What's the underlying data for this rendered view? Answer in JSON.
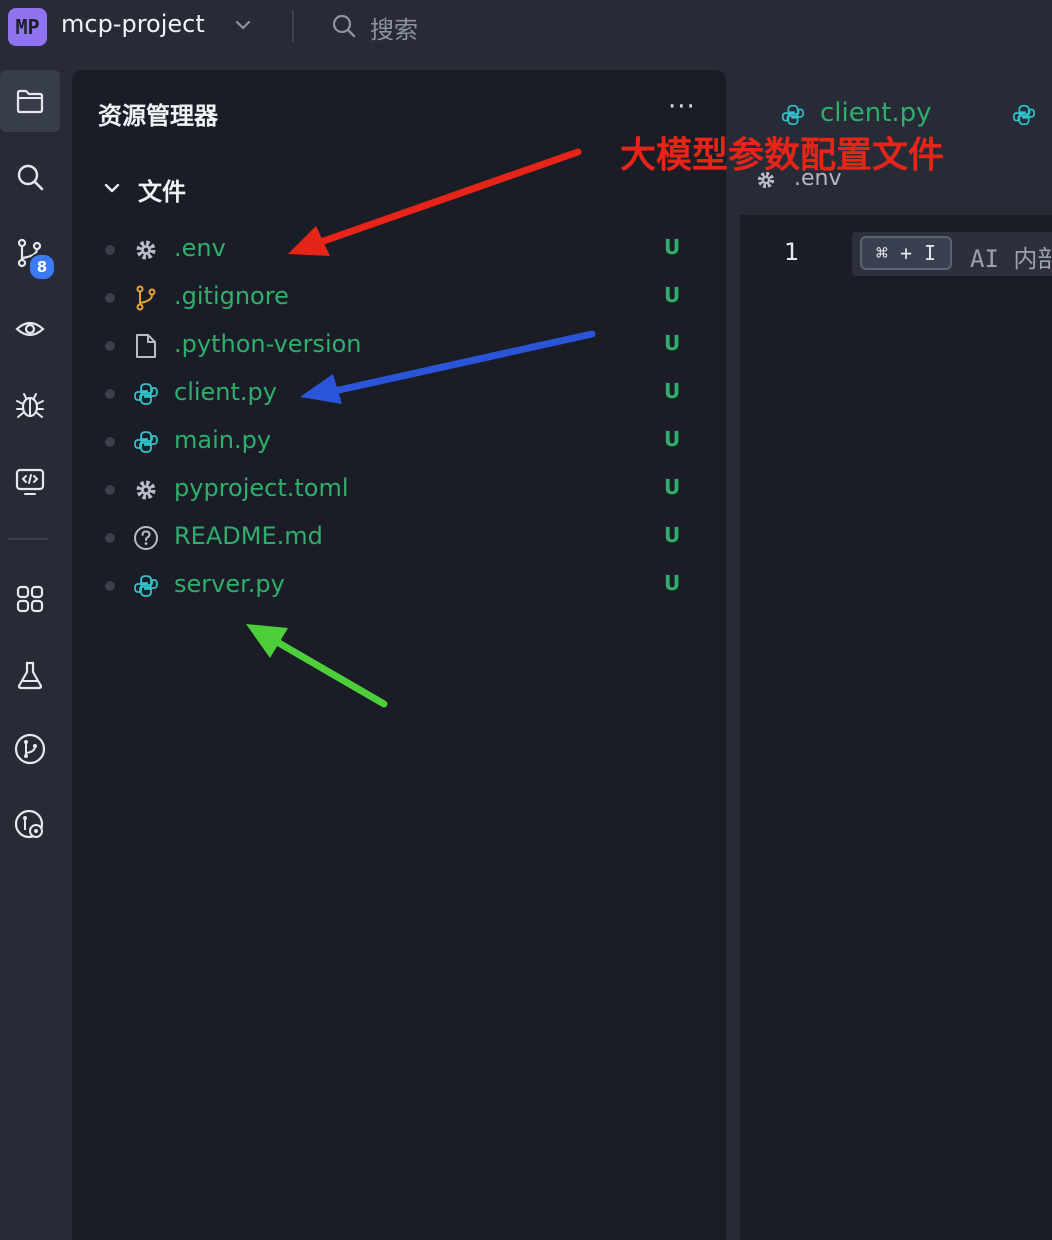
{
  "topbar": {
    "project_badge": "MP",
    "project_name": "mcp-project",
    "search_label": "搜索"
  },
  "activity_bar": {
    "items": [
      "explorer-icon",
      "search-icon",
      "source-control-icon",
      "watch-icon",
      "debug-icon",
      "remote-icon",
      "extensions-icon",
      "testing-icon",
      "git-graph-icon",
      "git-lens-icon"
    ],
    "source_control_badge": "8"
  },
  "explorer": {
    "title": "资源管理器",
    "more": "···",
    "section_label": "文件",
    "files": [
      {
        "name": ".env",
        "icon": "gear-icon",
        "status": "U"
      },
      {
        "name": ".gitignore",
        "icon": "git-branch-icon",
        "status": "U"
      },
      {
        "name": ".python-version",
        "icon": "file-icon",
        "status": "U"
      },
      {
        "name": "client.py",
        "icon": "python-icon",
        "status": "U"
      },
      {
        "name": "main.py",
        "icon": "python-icon",
        "status": "U"
      },
      {
        "name": "pyproject.toml",
        "icon": "gear-icon",
        "status": "U"
      },
      {
        "name": "README.md",
        "icon": "question-icon",
        "status": "U"
      },
      {
        "name": "server.py",
        "icon": "python-icon",
        "status": "U"
      }
    ]
  },
  "editor": {
    "tabs": [
      {
        "label": "client.py"
      }
    ],
    "breadcrumb": ".env",
    "line_number": "1",
    "shortcut": "⌘ + I",
    "hint": "AI 内部"
  },
  "annotations": {
    "label": "大模型参数配置文件",
    "colors": {
      "red": "#e62418",
      "blue": "#2a55d8",
      "green": "#4ccf3a"
    }
  },
  "colors": {
    "file_untracked": "#2fae6e",
    "accent_purple": "#8f73f0",
    "badge_blue": "#3c7bf5"
  }
}
